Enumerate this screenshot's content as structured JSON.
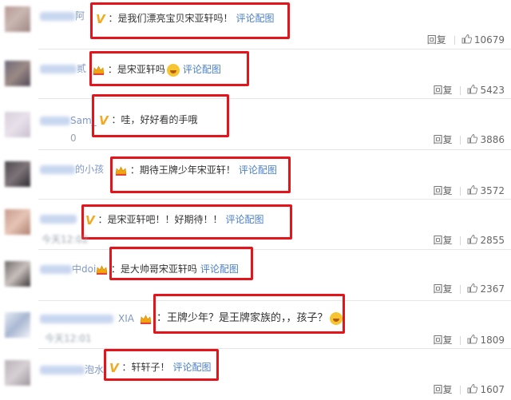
{
  "comments": [
    {
      "user_fragment": "阿",
      "badge": "v",
      "text": "：是我们漂亮宝贝宋亚轩吗！",
      "link": "评论配图",
      "time": "",
      "reply": "回复",
      "likes": "10679"
    },
    {
      "user_fragment": "贰",
      "badge": "crown",
      "text": "：是宋亚轩吗",
      "emoji": "laugh-cry-emoji",
      "link": "评论配图",
      "time": "",
      "reply": "回复",
      "likes": "5423"
    },
    {
      "user_fragment": "Sam_",
      "badge": "v",
      "text": "：哇，好好看的手哦",
      "link": "",
      "time": "0",
      "reply": "回复",
      "likes": "3886"
    },
    {
      "user_fragment": "的小孩",
      "badge": "crown",
      "text": "：期待王牌少年宋亚轩！",
      "link": "评论配图",
      "time": "",
      "reply": "回复",
      "likes": "3572"
    },
    {
      "user_fragment": "",
      "badge": "v",
      "text": "：是宋亚轩吧！！好期待！！",
      "link": "评论配图",
      "time": "今天12:02",
      "reply": "回复",
      "likes": "2855"
    },
    {
      "user_fragment": "中doi",
      "badge": "crown",
      "text": "：是大帅哥宋亚轩吗",
      "link": "评论配图",
      "time": "",
      "reply": "回复",
      "likes": "2367"
    },
    {
      "user_fragment": "XIA",
      "badge": "crown",
      "text": "：王牌少年？是王牌家族的，，孩子？",
      "emoji": "grin-sweat-emoji",
      "link": "",
      "time": "今天12:01",
      "reply": "回复",
      "likes": "1809"
    },
    {
      "user_fragment": "泡水",
      "badge": "v",
      "text": "：轩轩子！",
      "link": "评论配图",
      "time": "",
      "reply": "回复",
      "likes": "1607"
    }
  ],
  "colors": {
    "highlight_box": "#e5131a",
    "link": "#4a7fc9",
    "username": "#7f97c6",
    "badge_v": "#f4a81c"
  }
}
